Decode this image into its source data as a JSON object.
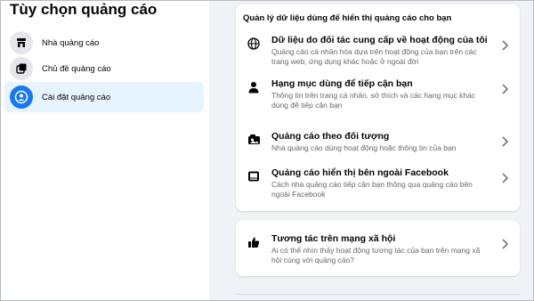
{
  "sidebar": {
    "title": "Tùy chọn quảng cáo",
    "items": [
      {
        "label": "Nhà quảng cáo",
        "icon": "store-icon",
        "active": false
      },
      {
        "label": "Chủ đề quảng cáo",
        "icon": "topics-icon",
        "active": false
      },
      {
        "label": "Cài đặt quảng cáo",
        "icon": "settings-user-icon",
        "active": true
      }
    ]
  },
  "main": {
    "data_card": {
      "header": "Quản lý dữ liệu dùng để hiển thị quảng cáo cho bạn",
      "rows": [
        {
          "title": "Dữ liệu do đối tác cung cấp về hoạt động của tôi",
          "desc": "Quảng cáo cá nhân hóa dựa trên hoạt động của bạn trên các trang web, ứng dụng khác hoặc ở ngoài đời",
          "icon": "globe-icon"
        },
        {
          "title": "Hạng mục dùng để tiếp cận bạn",
          "desc": "Thông tin trên trang cá nhân, sở thích và các hạng mục khác dùng để tiếp cận bạn",
          "icon": "person-icon"
        },
        {
          "title": "Quảng cáo theo đối tượng",
          "desc": "Nhà quảng cáo dùng hoạt động hoặc thông tin của bạn",
          "icon": "audience-icon"
        },
        {
          "title": "Quảng cáo hiển thị bên ngoài Facebook",
          "desc": "Cách nhà quảng cáo tiếp cận bạn thông qua quảng cáo bên ngoài Facebook",
          "icon": "external-screen-icon"
        }
      ]
    },
    "social_card": {
      "title": "Tương tác trên mạng xã hội",
      "desc": "Ai có thể nhìn thấy hoạt động tương tác của bạn trên mạng xã hội cùng với quảng cáo?",
      "icon": "thumbs-up-icon"
    }
  },
  "colors": {
    "accent": "#1877f2",
    "active_bg": "#e7f3ff",
    "content_bg": "#f0f2f5",
    "secondary_text": "#65676b"
  }
}
